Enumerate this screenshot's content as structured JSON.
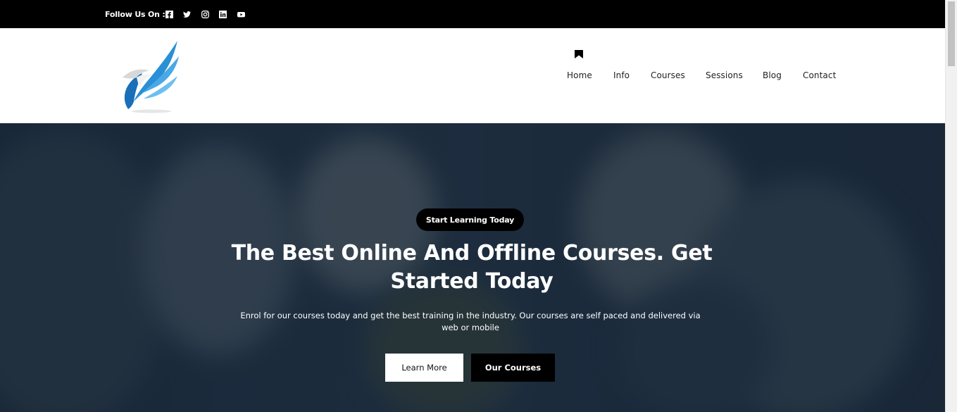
{
  "topbar": {
    "follow_label": "Follow Us On :",
    "social_icons": [
      "facebook-icon",
      "twitter-icon",
      "instagram-icon",
      "linkedin-icon",
      "youtube-icon"
    ]
  },
  "header": {
    "logo": "bird-wing-logo",
    "nav": [
      "Home",
      "Info",
      "Courses",
      "Sessions",
      "Blog",
      "Contact"
    ]
  },
  "hero": {
    "badge": "Start Learning Today",
    "title": "The Best Online And Offline Courses. Get Started Today",
    "description": "Enrol for our courses today and get the best training in the industry. Our courses are self paced and delivered via web or mobile",
    "buttons": {
      "learn_more": "Learn More",
      "our_courses": "Our Courses"
    }
  },
  "colors": {
    "topbar": "#000000",
    "hero_overlay": "#1a2a3a",
    "logo_blue": "#2a8fd6",
    "button_dark": "#000000",
    "button_light": "#ffffff"
  }
}
